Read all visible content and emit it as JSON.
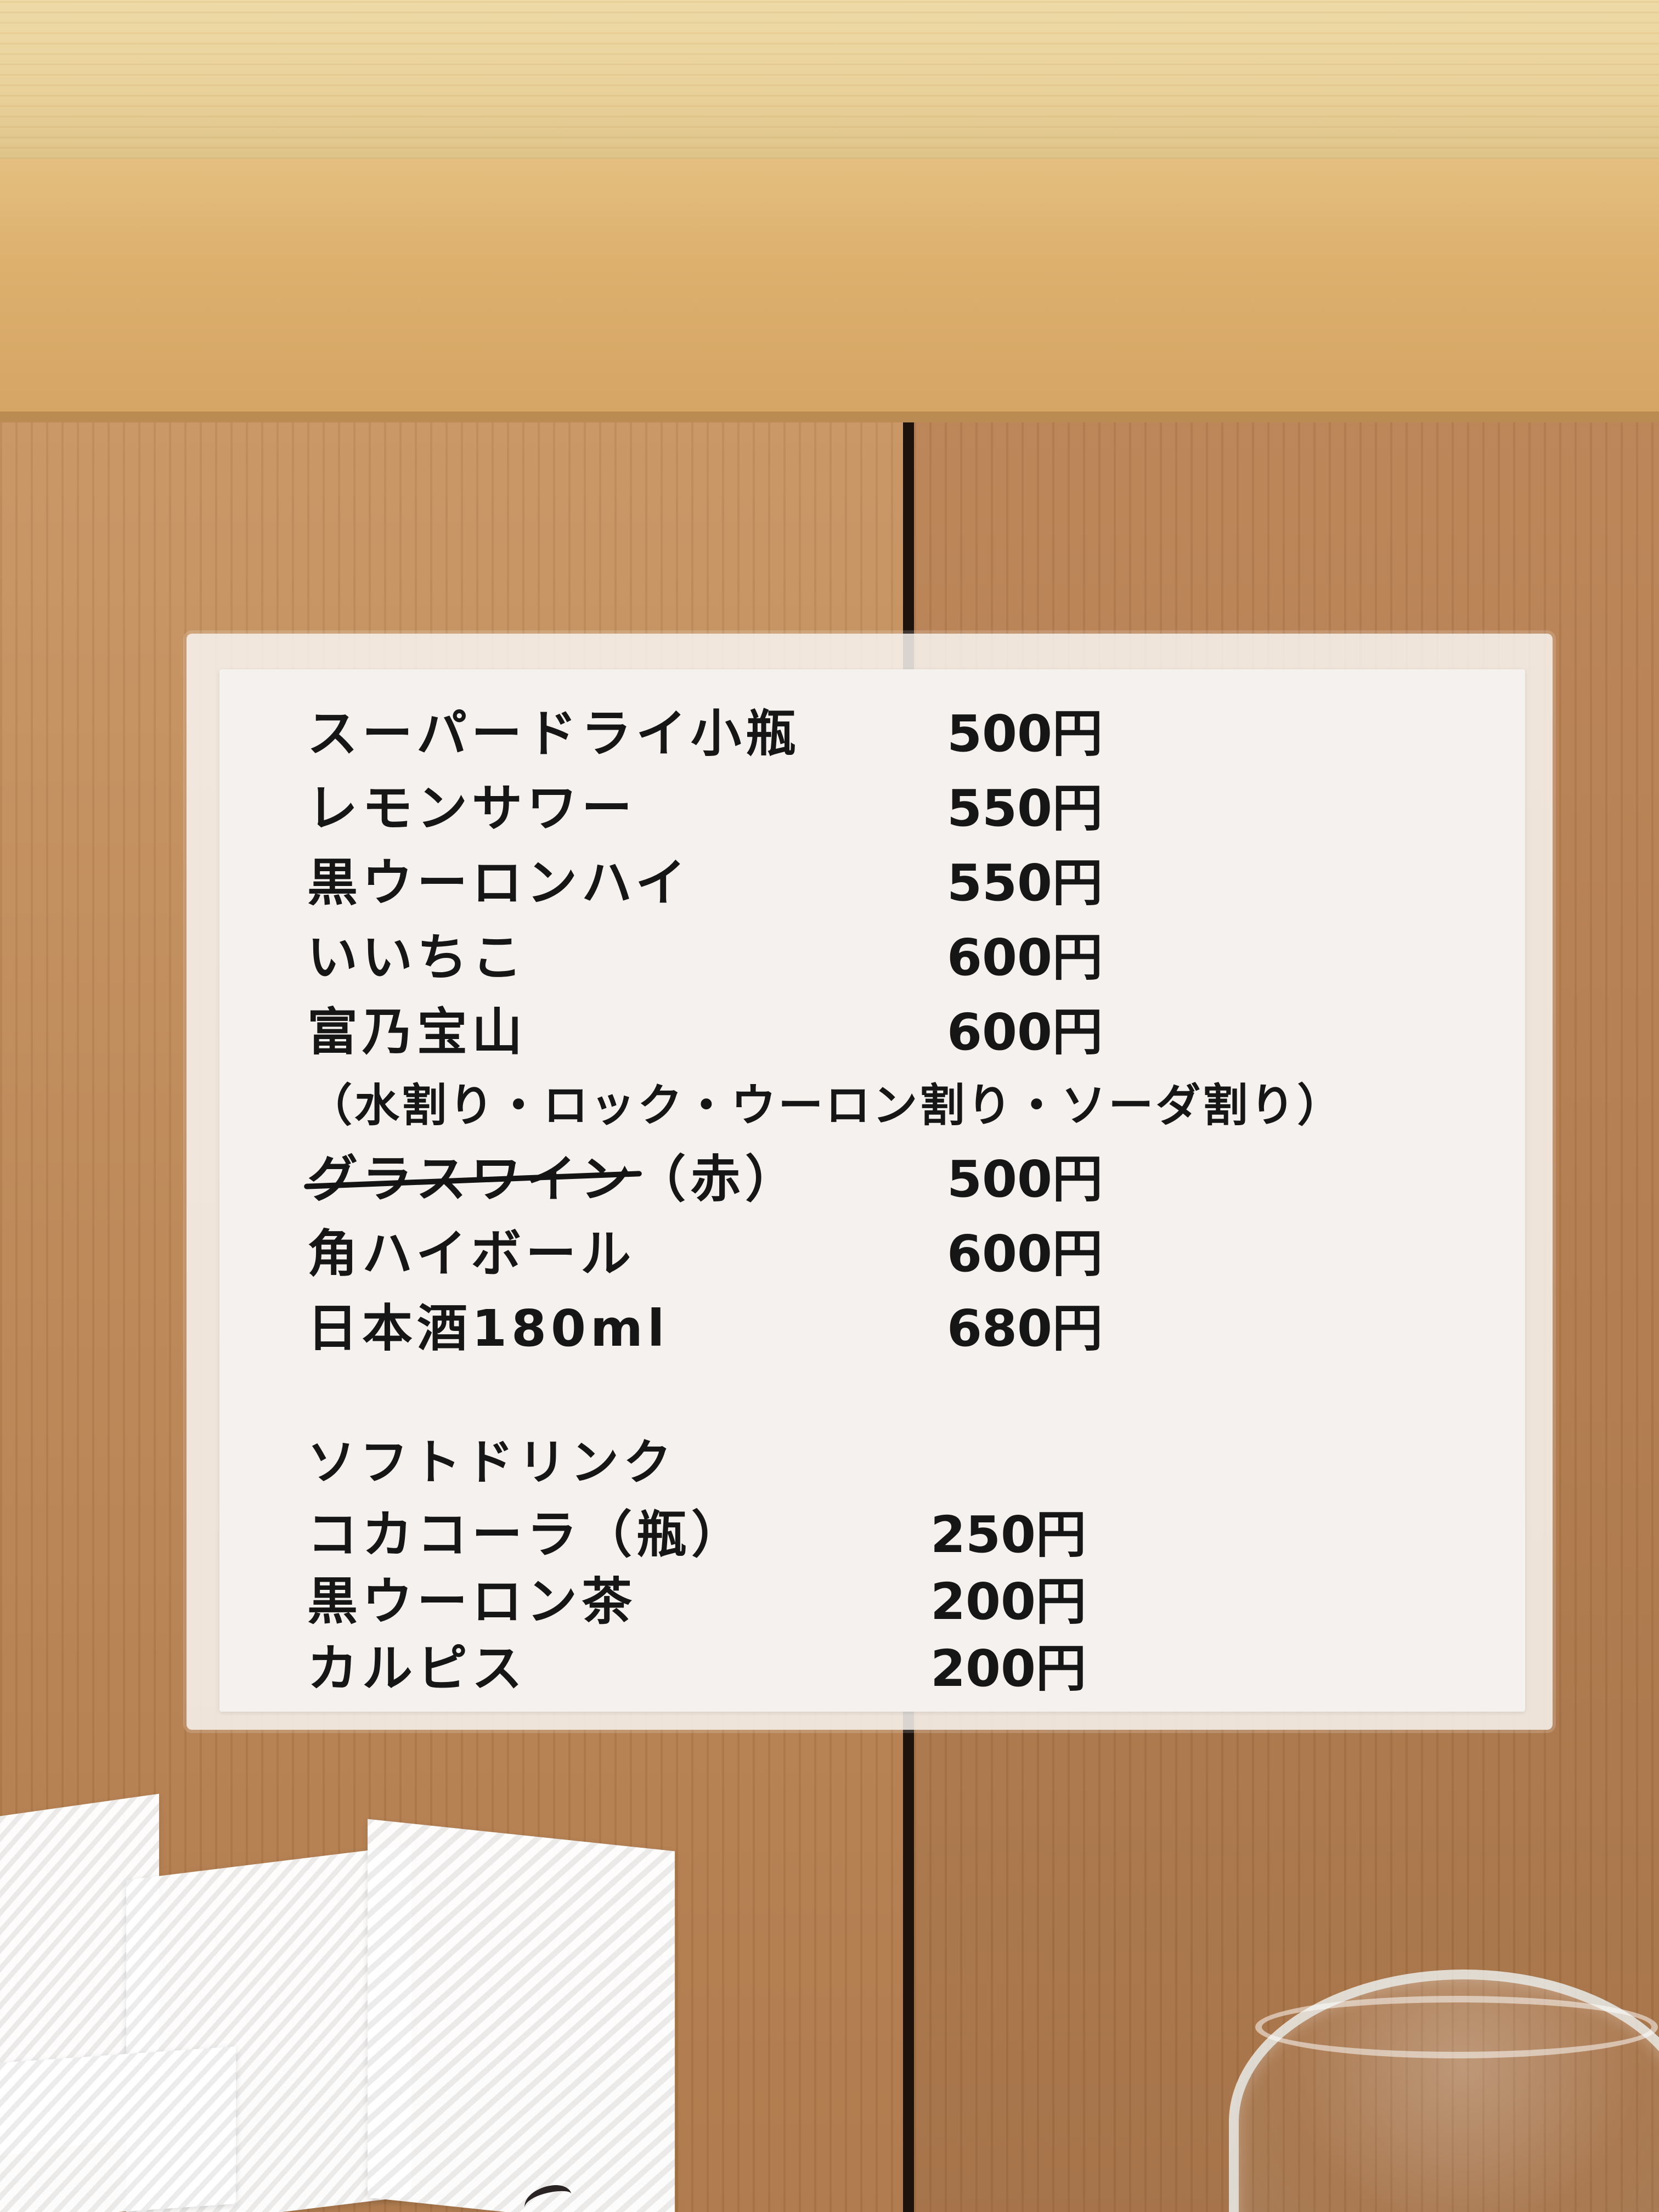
{
  "menu": {
    "items": [
      {
        "name": "スーパードライ小瓶",
        "price": "500円"
      },
      {
        "name": "レモンサワー",
        "price": "550円"
      },
      {
        "name": "黒ウーロンハイ",
        "price": "550円"
      },
      {
        "name": "いいちこ",
        "price": "600円"
      },
      {
        "name": "富乃宝山",
        "price": "600円"
      }
    ],
    "note": "（水割り・ロック・ウーロン割り・ソーダ割り）",
    "wine": {
      "name_struck": "グラスワイン",
      "suffix": "（赤）",
      "price": "500円"
    },
    "items_after_note": [
      {
        "name": "角ハイボール",
        "price": "600円"
      },
      {
        "name": "日本酒180ml",
        "price": "680円"
      }
    ],
    "soft_drinks_title": "ソフトドリンク",
    "soft_drinks": [
      {
        "name": "コカコーラ（瓶）",
        "price": "250円"
      },
      {
        "name": "黒ウーロン茶",
        "price": "200円"
      },
      {
        "name": "カルピス",
        "price": "200円"
      }
    ]
  }
}
